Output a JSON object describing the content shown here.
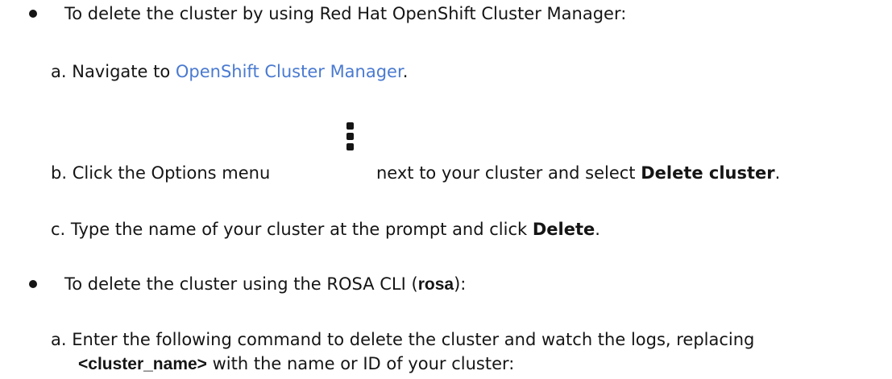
{
  "steps": {
    "console": {
      "intro": "To delete the cluster by using Red Hat OpenShift Cluster Manager:",
      "a": {
        "marker": "a.",
        "before": "Navigate to ",
        "link": "OpenShift Cluster Manager",
        "after": "."
      },
      "b": {
        "marker": "b.",
        "before": "Click the Options menu",
        "icon": "kebab-menu-icon",
        "middle": " next to your cluster and select ",
        "bold": "Delete cluster",
        "after": "."
      },
      "c": {
        "marker": "c.",
        "before": "Type the name of your cluster at the prompt and click ",
        "bold": "Delete",
        "after": "."
      }
    },
    "cli": {
      "intro_before": "To delete the cluster using the ROSA CLI (",
      "intro_bold": "rosa",
      "intro_after": "):",
      "a": {
        "marker": "a.",
        "line1": "Enter the following command to delete the cluster and watch the logs, replacing",
        "bold": "<cluster_name>",
        "line2_after": " with the name or ID of your cluster:"
      }
    }
  }
}
